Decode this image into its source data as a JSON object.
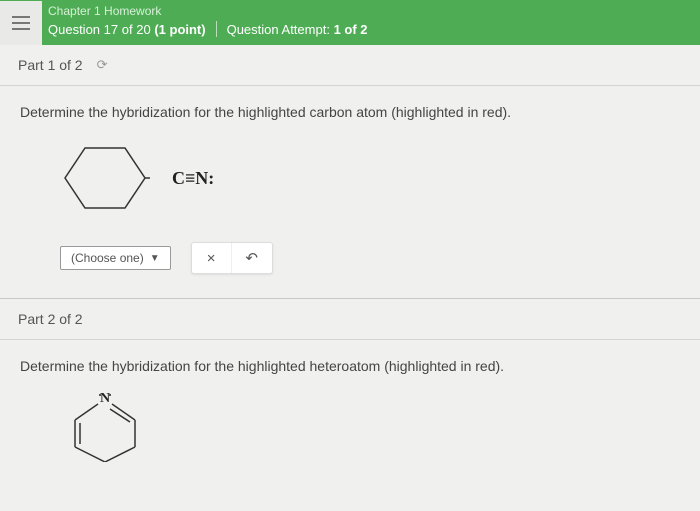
{
  "header": {
    "chapter_title": "Chapter 1 Homework",
    "question_prefix": "Question",
    "question_num": "17",
    "question_of": "of",
    "question_total": "20",
    "points": "(1 point)",
    "attempt_label": "Question Attempt:",
    "attempt_value": "1 of 2"
  },
  "part1": {
    "label": "Part 1 of 2",
    "prompt": "Determine the hybridization for the highlighted carbon atom (highlighted in red).",
    "formula": "C≡N:",
    "dropdown_label": "(Choose one)",
    "clear_label": "×",
    "undo_label": "↶"
  },
  "part2": {
    "label": "Part 2 of 2",
    "prompt": "Determine the hybridization for the highlighted heteroatom (highlighted in red).",
    "atom_label": "N"
  }
}
